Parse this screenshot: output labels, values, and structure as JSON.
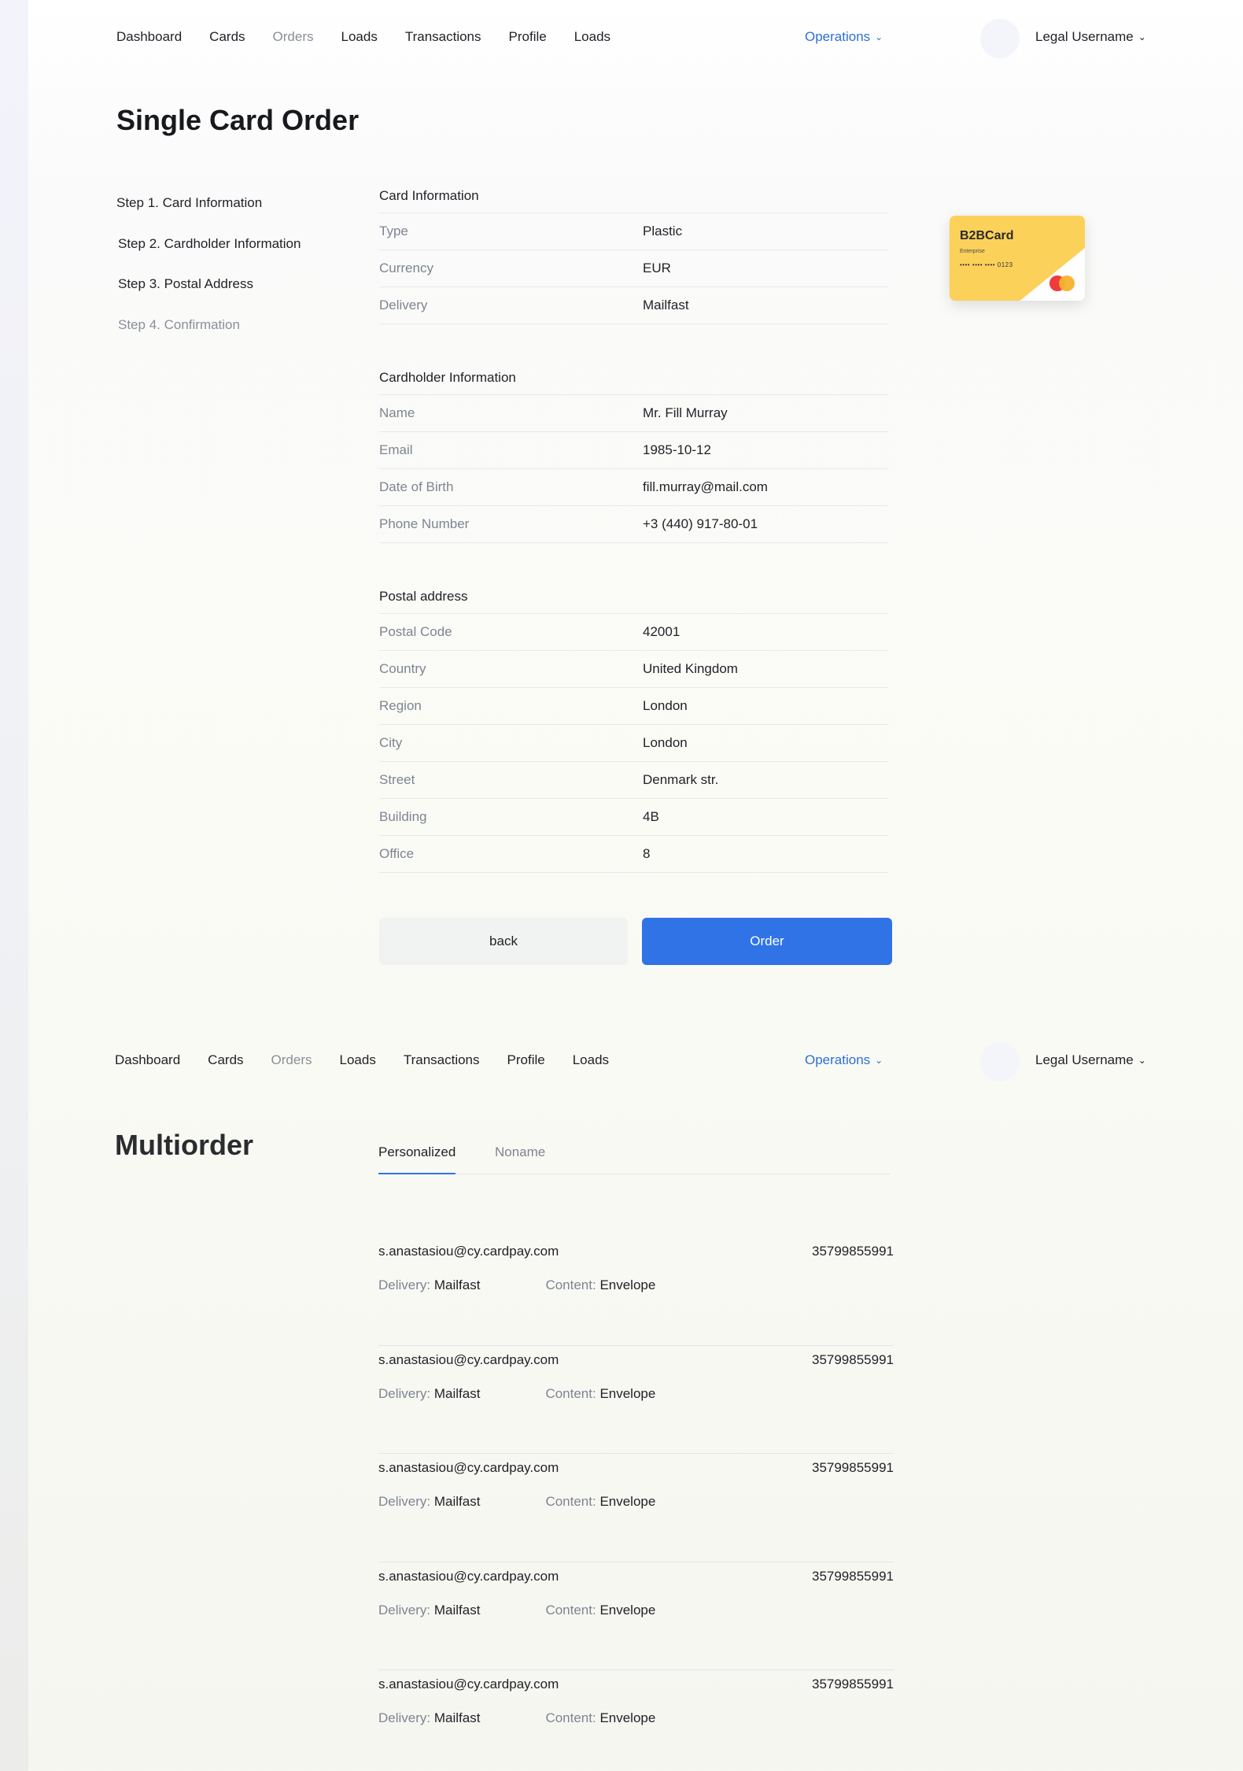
{
  "nav": {
    "links": [
      "Dashboard",
      "Cards",
      "Orders",
      "Loads",
      "Transactions",
      "Profile",
      "Loads"
    ],
    "active_index": 2,
    "operations_label": "Operations",
    "user_label": "Legal Username"
  },
  "single_order": {
    "title": "Single Card Order",
    "steps": [
      "Step 1. Card Information",
      "Step 2. Cardholder Information",
      "Step 3. Postal Address",
      "Step 4. Confirmation"
    ],
    "card_info": {
      "title": "Card Information",
      "rows": [
        {
          "label": "Type",
          "value": "Plastic"
        },
        {
          "label": "Currency",
          "value": "EUR"
        },
        {
          "label": "Delivery",
          "value": "Mailfast"
        }
      ]
    },
    "cardholder_info": {
      "title": "Cardholder Information",
      "rows": [
        {
          "label": "Name",
          "value": "Mr. Fill Murray"
        },
        {
          "label": "Email",
          "value": "1985-10-12"
        },
        {
          "label": "Date of Birth",
          "value": "fill.murray@mail.com"
        },
        {
          "label": "Phone Number",
          "value": "+3 (440) 917-80-01"
        }
      ]
    },
    "postal_address": {
      "title": "Postal address",
      "rows": [
        {
          "label": "Postal Code",
          "value": "42001"
        },
        {
          "label": "Country",
          "value": "United Kingdom"
        },
        {
          "label": "Region",
          "value": "London"
        },
        {
          "label": "City",
          "value": "London"
        },
        {
          "label": "Street",
          "value": "Denmark str."
        },
        {
          "label": "Building",
          "value": "4B"
        },
        {
          "label": "Office",
          "value": "8"
        }
      ]
    },
    "card_preview": {
      "brand": "B2BCard",
      "subtitle": "Enterprise",
      "number": "•••• •••• •••• 0123",
      "colors": {
        "card": "#fbd15a",
        "mc_red": "#ee3b3b",
        "mc_orange": "#f7b22c"
      }
    },
    "buttons": {
      "back": "back",
      "order": "Order"
    }
  },
  "multiorder": {
    "title": "Multiorder",
    "tabs": [
      "Personalized",
      "Noname"
    ],
    "active_tab": 0,
    "delivery_key": "Delivery:",
    "content_key": "Content:",
    "orders": [
      {
        "email": "s.anastasiou@cy.cardpay.com",
        "phone": "35799855991",
        "delivery": "Mailfast",
        "content": "Envelope"
      },
      {
        "email": "s.anastasiou@cy.cardpay.com",
        "phone": "35799855991",
        "delivery": "Mailfast",
        "content": "Envelope"
      },
      {
        "email": "s.anastasiou@cy.cardpay.com",
        "phone": "35799855991",
        "delivery": "Mailfast",
        "content": "Envelope"
      },
      {
        "email": "s.anastasiou@cy.cardpay.com",
        "phone": "35799855991",
        "delivery": "Mailfast",
        "content": "Envelope"
      },
      {
        "email": "s.anastasiou@cy.cardpay.com",
        "phone": "35799855991",
        "delivery": "Mailfast",
        "content": "Envelope"
      }
    ]
  },
  "colors": {
    "accent": "#2f73e6",
    "link": "#2c6fd9",
    "muted": "#7e8491"
  }
}
